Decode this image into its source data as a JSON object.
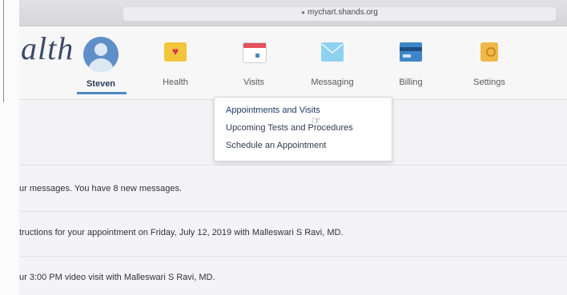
{
  "browser": {
    "url": "mychart.shands.org"
  },
  "header": {
    "logo_text": "alth",
    "user_name": "Steven",
    "nav_items": [
      {
        "label": "Health",
        "icon": "heart-icon"
      },
      {
        "label": "Visits",
        "icon": "calendar-icon"
      },
      {
        "label": "Messaging",
        "icon": "envelope-icon"
      },
      {
        "label": "Billing",
        "icon": "credit-card-icon"
      },
      {
        "label": "Settings",
        "icon": "settings-icon"
      }
    ]
  },
  "visits_menu": {
    "items": [
      "Appointments and Visits",
      "Upcoming Tests and Procedures",
      "Schedule an Appointment"
    ]
  },
  "feed": {
    "rows": [
      "ur messages. You have 8 new messages.",
      "tructions for your appointment on Friday, July 12, 2019 with Malleswari S Ravi, MD.",
      "ur 3:00 PM video visit with Malleswari S Ravi, MD."
    ]
  },
  "colors": {
    "accent": "#4c87c6",
    "avatar": "#5f8fc8",
    "logo": "#3d4a66"
  }
}
